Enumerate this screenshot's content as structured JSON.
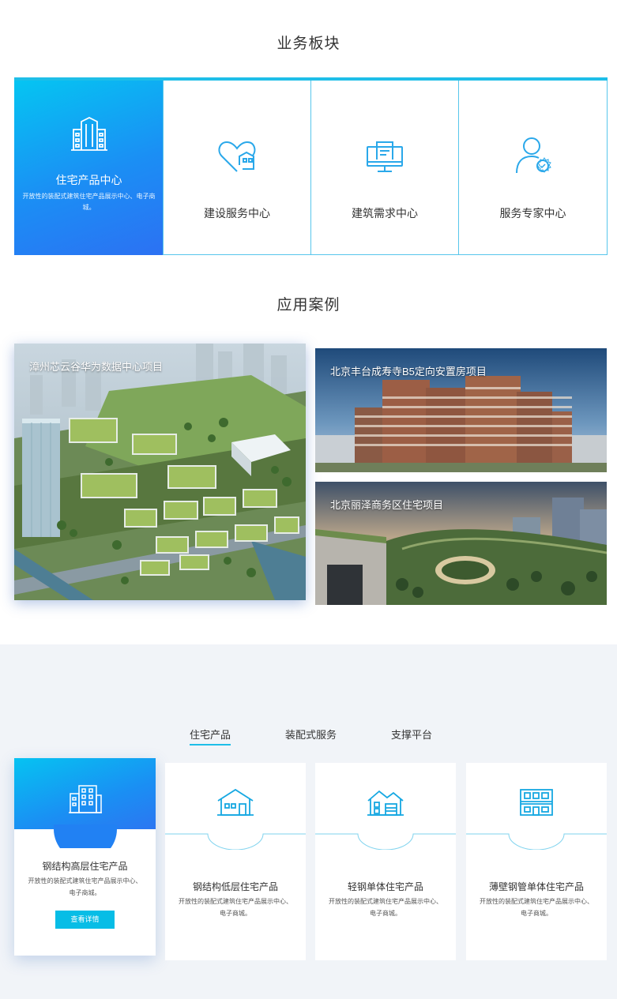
{
  "business": {
    "title": "业务板块",
    "cards": [
      {
        "label": "住宅产品中心",
        "desc": "开放性的装配式建筑住宅产品展示中心、电子商城。",
        "icon": "building-icon",
        "active": true
      },
      {
        "label": "建设服务中心",
        "icon": "heart-house-icon"
      },
      {
        "label": "建筑需求中心",
        "icon": "monitor-document-icon"
      },
      {
        "label": "服务专家中心",
        "icon": "person-badge-icon"
      }
    ]
  },
  "cases": {
    "title": "应用案例",
    "items": [
      {
        "label": "漳州芯云谷华为数据中心项目"
      },
      {
        "label": "北京丰台成寿寺B5定向安置房项目"
      },
      {
        "label": "北京丽泽商务区住宅项目"
      }
    ]
  },
  "products": {
    "tabs": [
      "住宅产品",
      "装配式服务",
      "支撑平台"
    ],
    "active_tab": "住宅产品",
    "cards": [
      {
        "title": "钢结构高层住宅产品",
        "desc": "开放性的装配式建筑住宅产品展示中心、电子商城。",
        "button": "查看详情",
        "icon": "highrise-icon"
      },
      {
        "title": "钢结构低层住宅产品",
        "desc": "开放性的装配式建筑住宅产品展示中心、电子商城。",
        "icon": "low-house-icon"
      },
      {
        "title": "轻钢单体住宅产品",
        "desc": "开放性的装配式建筑住宅产品展示中心、电子商城。",
        "icon": "single-house-icon"
      },
      {
        "title": "薄壁钢管单体住宅产品",
        "desc": "开放性的装配式建筑住宅产品展示中心、电子商城。",
        "icon": "container-house-icon"
      }
    ]
  },
  "colors": {
    "accent": "#1ebee8",
    "gradient_start": "#05c5f2",
    "gradient_end": "#2c71f3",
    "bg": "#f1f4f8"
  }
}
